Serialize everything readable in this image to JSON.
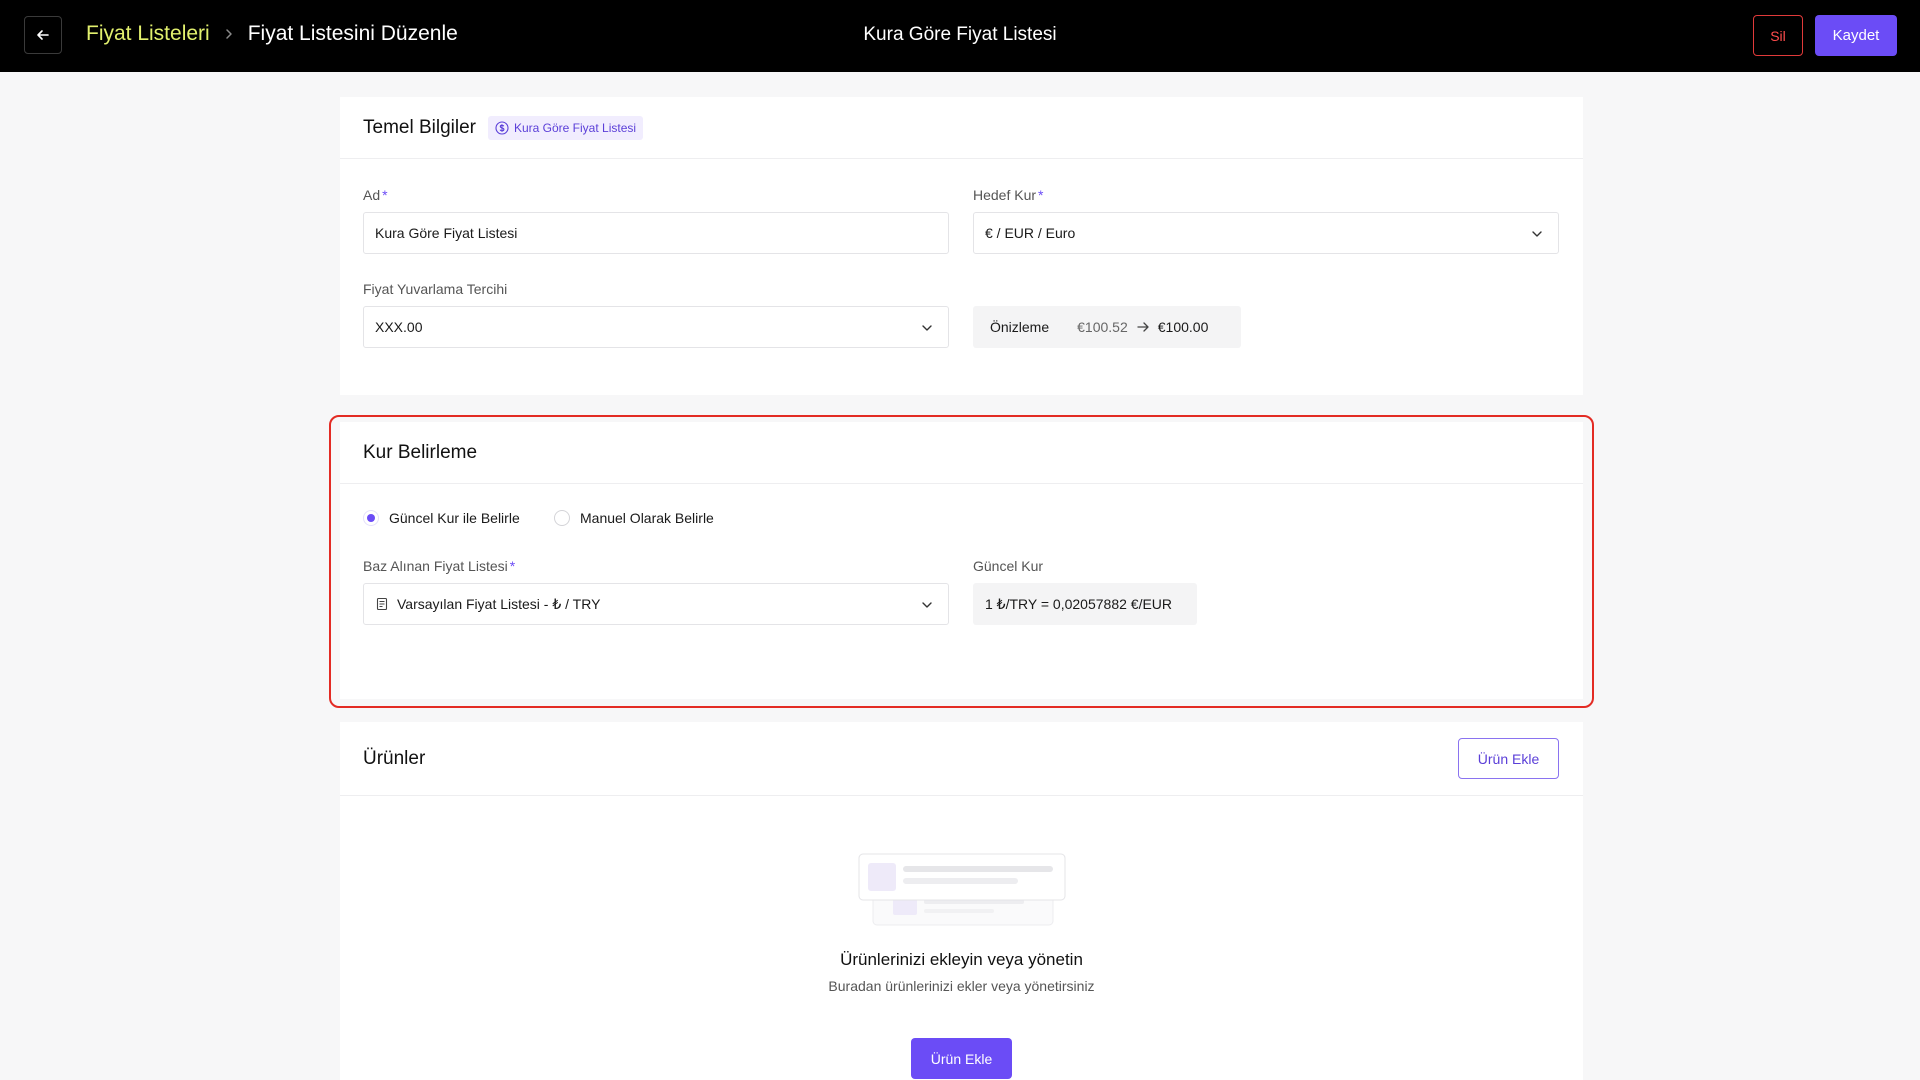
{
  "header": {
    "breadcrumb_link": "Fiyat Listeleri",
    "breadcrumb_current": "Fiyat Listesini Düzenle",
    "page_title": "Kura Göre Fiyat Listesi",
    "delete_label": "Sil",
    "save_label": "Kaydet"
  },
  "basic_info": {
    "title": "Temel Bilgiler",
    "badge": "Kura Göre Fiyat Listesi",
    "name_label": "Ad",
    "name_value": "Kura Göre Fiyat Listesi",
    "target_currency_label": "Hedef Kur",
    "target_currency_value": "€ / EUR / Euro",
    "rounding_label": "Fiyat Yuvarlama Tercihi",
    "rounding_value": "XXX.00",
    "preview_label": "Önizleme",
    "preview_before": "€100.52",
    "preview_after": "€100.00"
  },
  "rate": {
    "title": "Kur Belirleme",
    "option_current": "Güncel Kur ile Belirle",
    "option_manual": "Manuel Olarak Belirle",
    "selected_option": "current",
    "base_list_label": "Baz Alınan Fiyat Listesi",
    "base_list_value": "Varsayılan Fiyat Listesi - ₺ / TRY",
    "current_rate_label": "Güncel Kur",
    "current_rate_value": "1 ₺/TRY = 0,02057882 €/EUR"
  },
  "products": {
    "title": "Ürünler",
    "add_label": "Ürün Ekle",
    "empty_title": "Ürünlerinizi ekleyin veya yönetin",
    "empty_subtitle": "Buradan ürünlerinizi ekler veya yönetirsiniz",
    "empty_add_label": "Ürün Ekle"
  },
  "colors": {
    "accent": "#6b4cf6",
    "breadcrumb_link": "#e2f06e",
    "danger": "#e03a3a",
    "highlight_border": "#e32b24"
  }
}
